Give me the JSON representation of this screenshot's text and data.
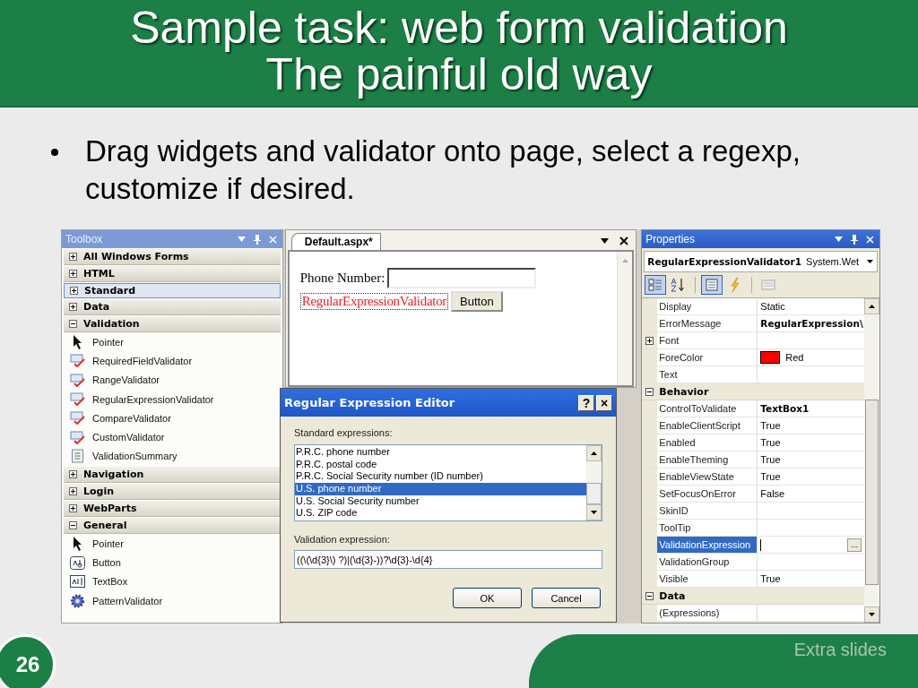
{
  "slide": {
    "title_lines": [
      "Sample task: web form validation",
      "The painful old way"
    ],
    "bullets": [
      "Drag widgets and validator onto page, select a regexp, customize if desired."
    ],
    "page_number": "26",
    "footer": "Extra slides"
  },
  "toolbox": {
    "title": "Toolbox",
    "groups": [
      {
        "label": "All Windows Forms",
        "expanded": false,
        "selected": false
      },
      {
        "label": "HTML",
        "expanded": false,
        "selected": false
      },
      {
        "label": "Standard",
        "expanded": false,
        "selected": true
      },
      {
        "label": "Data",
        "expanded": false,
        "selected": false
      },
      {
        "label": "Validation",
        "expanded": true,
        "selected": false,
        "items": [
          "Pointer",
          "RequiredFieldValidator",
          "RangeValidator",
          "RegularExpressionValidator",
          "CompareValidator",
          "CustomValidator",
          "ValidationSummary"
        ]
      },
      {
        "label": "Navigation",
        "expanded": false,
        "selected": false
      },
      {
        "label": "Login",
        "expanded": false,
        "selected": false
      },
      {
        "label": "WebParts",
        "expanded": false,
        "selected": false
      },
      {
        "label": "General",
        "expanded": true,
        "selected": false,
        "items": [
          "Pointer",
          "Button",
          "TextBox",
          "PatternValidator"
        ]
      }
    ]
  },
  "designer": {
    "tab": "Default.aspx*",
    "label": "Phone Number:",
    "validator_text": "RegularExpressionValidator",
    "button": "Button"
  },
  "dialog": {
    "title": "Regular Expression Editor",
    "help": "?",
    "close": "×",
    "list_label": "Standard expressions:",
    "items": [
      {
        "label": "P.R.C. phone number",
        "selected": false
      },
      {
        "label": "P.R.C. postal code",
        "selected": false
      },
      {
        "label": "P.R.C. Social Security number (ID number)",
        "selected": false
      },
      {
        "label": "U.S. phone number",
        "selected": true
      },
      {
        "label": "U.S. Social Security number",
        "selected": false
      },
      {
        "label": "U.S. ZIP code",
        "selected": false
      }
    ],
    "expression_label": "Validation expression:",
    "expression": "((\\(\\d{3}\\) ?)|(\\d{3}-))?\\d{3}-\\d{4}",
    "ok": "OK",
    "cancel": "Cancel"
  },
  "properties": {
    "title": "Properties",
    "object_name": "RegularExpressionValidator1",
    "object_type": "System.Wet",
    "rows": [
      {
        "kind": "property",
        "name": "Display",
        "value": "Static",
        "bold": false,
        "selected": false
      },
      {
        "kind": "property",
        "name": "ErrorMessage",
        "value": "RegularExpression\\",
        "bold": true,
        "selected": false
      },
      {
        "kind": "property",
        "name": "Font",
        "value": "",
        "selected": false,
        "expanded": false
      },
      {
        "kind": "property",
        "name": "ForeColor",
        "value": "Red",
        "bold": false,
        "selected": false,
        "color": "#ff0000"
      },
      {
        "kind": "property",
        "name": "Text",
        "value": "",
        "selected": false
      },
      {
        "kind": "category",
        "name": "Behavior",
        "expanded": true
      },
      {
        "kind": "property",
        "name": "ControlToValidate",
        "value": "TextBox1",
        "bold": true,
        "selected": false
      },
      {
        "kind": "property",
        "name": "EnableClientScript",
        "value": "True",
        "bold": false,
        "selected": false
      },
      {
        "kind": "property",
        "name": "Enabled",
        "value": "True",
        "bold": false,
        "selected": false
      },
      {
        "kind": "property",
        "name": "EnableTheming",
        "value": "True",
        "bold": false,
        "selected": false
      },
      {
        "kind": "property",
        "name": "EnableViewState",
        "value": "True",
        "bold": false,
        "selected": false
      },
      {
        "kind": "property",
        "name": "SetFocusOnError",
        "value": "False",
        "bold": false,
        "selected": false
      },
      {
        "kind": "property",
        "name": "SkinID",
        "value": "",
        "selected": false
      },
      {
        "kind": "property",
        "name": "ToolTip",
        "value": "",
        "selected": false
      },
      {
        "kind": "property",
        "name": "ValidationExpression",
        "value": "",
        "selected": true,
        "button": "..."
      },
      {
        "kind": "property",
        "name": "ValidationGroup",
        "value": "",
        "selected": false
      },
      {
        "kind": "property",
        "name": "Visible",
        "value": "True",
        "bold": false,
        "selected": false
      },
      {
        "kind": "category",
        "name": "Data",
        "expanded": true
      },
      {
        "kind": "property",
        "name": "(Expressions)",
        "value": "",
        "selected": false
      }
    ]
  }
}
